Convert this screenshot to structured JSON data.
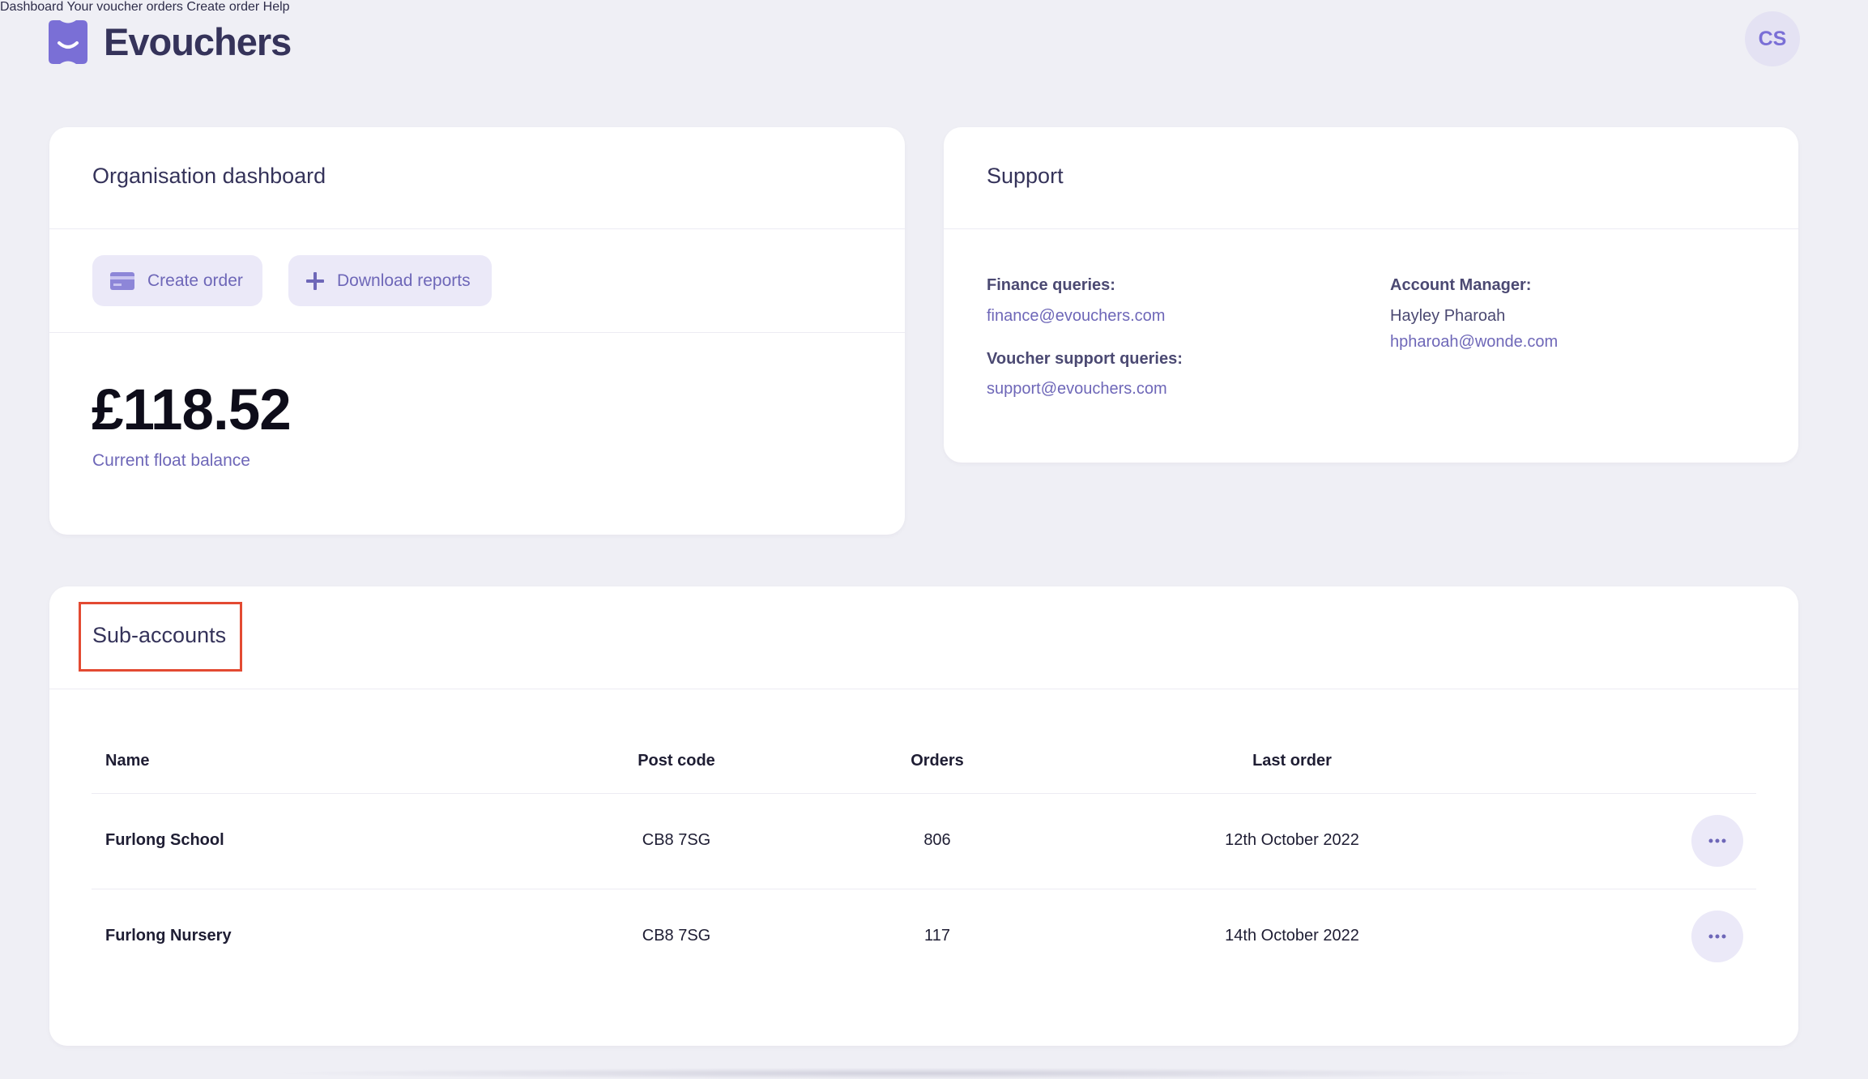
{
  "brand": {
    "name": "Evouchers",
    "color": "#7a6fd6"
  },
  "nav": {
    "items": [
      {
        "label": "Dashboard"
      },
      {
        "label": "Your voucher orders"
      },
      {
        "label": "Create order"
      },
      {
        "label": "Help"
      }
    ],
    "avatar_initials": "CS"
  },
  "org_card": {
    "title": "Organisation dashboard",
    "create_order_label": "Create order",
    "download_reports_label": "Download reports",
    "balance": "£118.52",
    "balance_label": "Current float balance"
  },
  "support": {
    "title": "Support",
    "finance_label": "Finance queries:",
    "finance_email": "finance@evouchers.com",
    "voucher_label": "Voucher support queries:",
    "voucher_email": "support@evouchers.com",
    "manager_label": "Account Manager:",
    "manager_name": "Hayley Pharoah",
    "manager_email": "hpharoah@wonde.com"
  },
  "sub_accounts": {
    "title": "Sub-accounts",
    "columns": {
      "name": "Name",
      "postcode": "Post code",
      "orders": "Orders",
      "last_order": "Last order"
    },
    "rows": [
      {
        "name": "Furlong School",
        "postcode": "CB8 7SG",
        "orders": "806",
        "last_order": "12th October 2022"
      },
      {
        "name": "Furlong Nursery",
        "postcode": "CB8 7SG",
        "orders": "117",
        "last_order": "14th October 2022"
      }
    ]
  },
  "icons": [
    "logo-icon",
    "card-icon",
    "plus-icon",
    "more-icon"
  ]
}
